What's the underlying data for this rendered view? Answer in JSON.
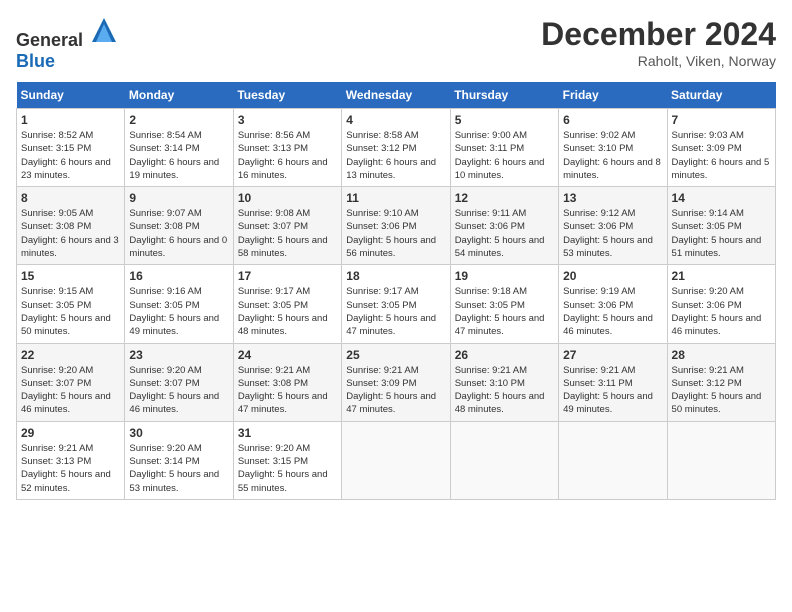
{
  "header": {
    "logo_general": "General",
    "logo_blue": "Blue",
    "month_title": "December 2024",
    "location": "Raholt, Viken, Norway"
  },
  "weekdays": [
    "Sunday",
    "Monday",
    "Tuesday",
    "Wednesday",
    "Thursday",
    "Friday",
    "Saturday"
  ],
  "weeks": [
    [
      {
        "day": "1",
        "sunrise": "8:52 AM",
        "sunset": "3:15 PM",
        "daylight": "6 hours and 23 minutes."
      },
      {
        "day": "2",
        "sunrise": "8:54 AM",
        "sunset": "3:14 PM",
        "daylight": "6 hours and 19 minutes."
      },
      {
        "day": "3",
        "sunrise": "8:56 AM",
        "sunset": "3:13 PM",
        "daylight": "6 hours and 16 minutes."
      },
      {
        "day": "4",
        "sunrise": "8:58 AM",
        "sunset": "3:12 PM",
        "daylight": "6 hours and 13 minutes."
      },
      {
        "day": "5",
        "sunrise": "9:00 AM",
        "sunset": "3:11 PM",
        "daylight": "6 hours and 10 minutes."
      },
      {
        "day": "6",
        "sunrise": "9:02 AM",
        "sunset": "3:10 PM",
        "daylight": "6 hours and 8 minutes."
      },
      {
        "day": "7",
        "sunrise": "9:03 AM",
        "sunset": "3:09 PM",
        "daylight": "6 hours and 5 minutes."
      }
    ],
    [
      {
        "day": "8",
        "sunrise": "9:05 AM",
        "sunset": "3:08 PM",
        "daylight": "6 hours and 3 minutes."
      },
      {
        "day": "9",
        "sunrise": "9:07 AM",
        "sunset": "3:08 PM",
        "daylight": "6 hours and 0 minutes."
      },
      {
        "day": "10",
        "sunrise": "9:08 AM",
        "sunset": "3:07 PM",
        "daylight": "5 hours and 58 minutes."
      },
      {
        "day": "11",
        "sunrise": "9:10 AM",
        "sunset": "3:06 PM",
        "daylight": "5 hours and 56 minutes."
      },
      {
        "day": "12",
        "sunrise": "9:11 AM",
        "sunset": "3:06 PM",
        "daylight": "5 hours and 54 minutes."
      },
      {
        "day": "13",
        "sunrise": "9:12 AM",
        "sunset": "3:06 PM",
        "daylight": "5 hours and 53 minutes."
      },
      {
        "day": "14",
        "sunrise": "9:14 AM",
        "sunset": "3:05 PM",
        "daylight": "5 hours and 51 minutes."
      }
    ],
    [
      {
        "day": "15",
        "sunrise": "9:15 AM",
        "sunset": "3:05 PM",
        "daylight": "5 hours and 50 minutes."
      },
      {
        "day": "16",
        "sunrise": "9:16 AM",
        "sunset": "3:05 PM",
        "daylight": "5 hours and 49 minutes."
      },
      {
        "day": "17",
        "sunrise": "9:17 AM",
        "sunset": "3:05 PM",
        "daylight": "5 hours and 48 minutes."
      },
      {
        "day": "18",
        "sunrise": "9:17 AM",
        "sunset": "3:05 PM",
        "daylight": "5 hours and 47 minutes."
      },
      {
        "day": "19",
        "sunrise": "9:18 AM",
        "sunset": "3:05 PM",
        "daylight": "5 hours and 47 minutes."
      },
      {
        "day": "20",
        "sunrise": "9:19 AM",
        "sunset": "3:06 PM",
        "daylight": "5 hours and 46 minutes."
      },
      {
        "day": "21",
        "sunrise": "9:20 AM",
        "sunset": "3:06 PM",
        "daylight": "5 hours and 46 minutes."
      }
    ],
    [
      {
        "day": "22",
        "sunrise": "9:20 AM",
        "sunset": "3:07 PM",
        "daylight": "5 hours and 46 minutes."
      },
      {
        "day": "23",
        "sunrise": "9:20 AM",
        "sunset": "3:07 PM",
        "daylight": "5 hours and 46 minutes."
      },
      {
        "day": "24",
        "sunrise": "9:21 AM",
        "sunset": "3:08 PM",
        "daylight": "5 hours and 47 minutes."
      },
      {
        "day": "25",
        "sunrise": "9:21 AM",
        "sunset": "3:09 PM",
        "daylight": "5 hours and 47 minutes."
      },
      {
        "day": "26",
        "sunrise": "9:21 AM",
        "sunset": "3:10 PM",
        "daylight": "5 hours and 48 minutes."
      },
      {
        "day": "27",
        "sunrise": "9:21 AM",
        "sunset": "3:11 PM",
        "daylight": "5 hours and 49 minutes."
      },
      {
        "day": "28",
        "sunrise": "9:21 AM",
        "sunset": "3:12 PM",
        "daylight": "5 hours and 50 minutes."
      }
    ],
    [
      {
        "day": "29",
        "sunrise": "9:21 AM",
        "sunset": "3:13 PM",
        "daylight": "5 hours and 52 minutes."
      },
      {
        "day": "30",
        "sunrise": "9:20 AM",
        "sunset": "3:14 PM",
        "daylight": "5 hours and 53 minutes."
      },
      {
        "day": "31",
        "sunrise": "9:20 AM",
        "sunset": "3:15 PM",
        "daylight": "5 hours and 55 minutes."
      },
      null,
      null,
      null,
      null
    ]
  ],
  "labels": {
    "sunrise": "Sunrise:",
    "sunset": "Sunset:",
    "daylight": "Daylight:"
  }
}
